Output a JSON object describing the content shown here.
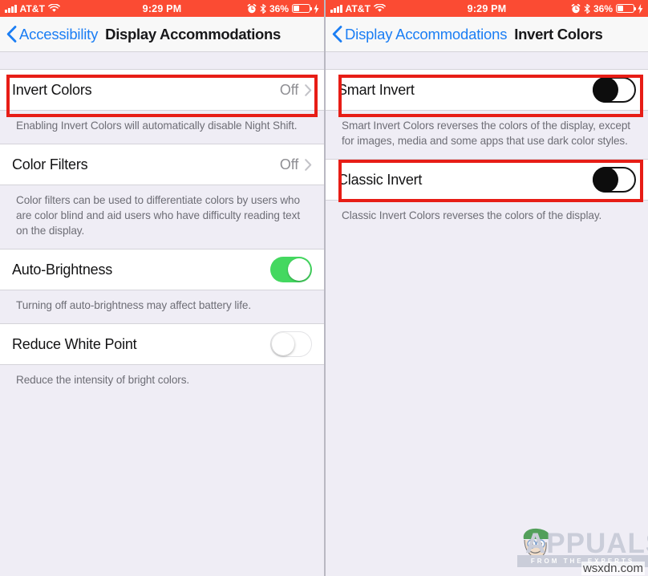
{
  "colors": {
    "status_bar": "#FB4B33",
    "accent_blue": "#1B7EF4",
    "toggle_on_green": "#44D860",
    "highlight_red": "#E71D16",
    "page_background": "#EFEDF5"
  },
  "left_screen": {
    "status_bar": {
      "carrier": "AT&T",
      "signal_icon": "signal-bars-icon",
      "wifi_icon": "wifi-icon",
      "time": "9:29 PM",
      "alarm_icon": "alarm-clock-icon",
      "bluetooth_icon": "bluetooth-icon",
      "battery_percent": "36%",
      "battery_icon": "battery-icon",
      "charging_icon": "lightning-bolt-icon"
    },
    "nav": {
      "back_icon": "chevron-left-icon",
      "back_label": "Accessibility",
      "title": "Display Accommodations"
    },
    "rows": [
      {
        "label": "Invert Colors",
        "value": "Off",
        "accessory": "disclosure-chevron-icon",
        "footnote": "Enabling Invert Colors will automatically disable Night Shift.",
        "highlighted": true
      },
      {
        "label": "Color Filters",
        "value": "Off",
        "accessory": "disclosure-chevron-icon",
        "footnote": "Color filters can be used to differentiate colors by users who are color blind and aid users who have difficulty reading text on the display.",
        "highlighted": false
      },
      {
        "label": "Auto-Brightness",
        "value": "",
        "accessory": "toggle-on",
        "footnote": "Turning off auto-brightness may affect battery life.",
        "highlighted": false
      },
      {
        "label": "Reduce White Point",
        "value": "",
        "accessory": "toggle-off",
        "footnote": "Reduce the intensity of bright colors.",
        "highlighted": false
      }
    ]
  },
  "right_screen": {
    "status_bar": {
      "carrier": "AT&T",
      "signal_icon": "signal-bars-icon",
      "wifi_icon": "wifi-icon",
      "time": "9:29 PM",
      "alarm_icon": "alarm-clock-icon",
      "bluetooth_icon": "bluetooth-icon",
      "battery_percent": "36%",
      "battery_icon": "battery-icon",
      "charging_icon": "lightning-bolt-icon"
    },
    "nav": {
      "back_icon": "chevron-left-icon",
      "back_label": "Display Accommodations",
      "title": "Invert Colors"
    },
    "rows": [
      {
        "label": "Smart Invert",
        "value": "",
        "accessory": "toggle-dark",
        "footnote": "Smart Invert Colors reverses the colors of the display, except for images, media and some apps that use dark color styles.",
        "highlighted": true
      },
      {
        "label": "Classic Invert",
        "value": "",
        "accessory": "toggle-dark",
        "footnote": "Classic Invert Colors reverses the colors of the display.",
        "highlighted": true
      }
    ]
  },
  "watermark": {
    "word": "APPUALS",
    "tagline": "FROM THE EXPERTS",
    "domain": "wsxdn.com"
  }
}
